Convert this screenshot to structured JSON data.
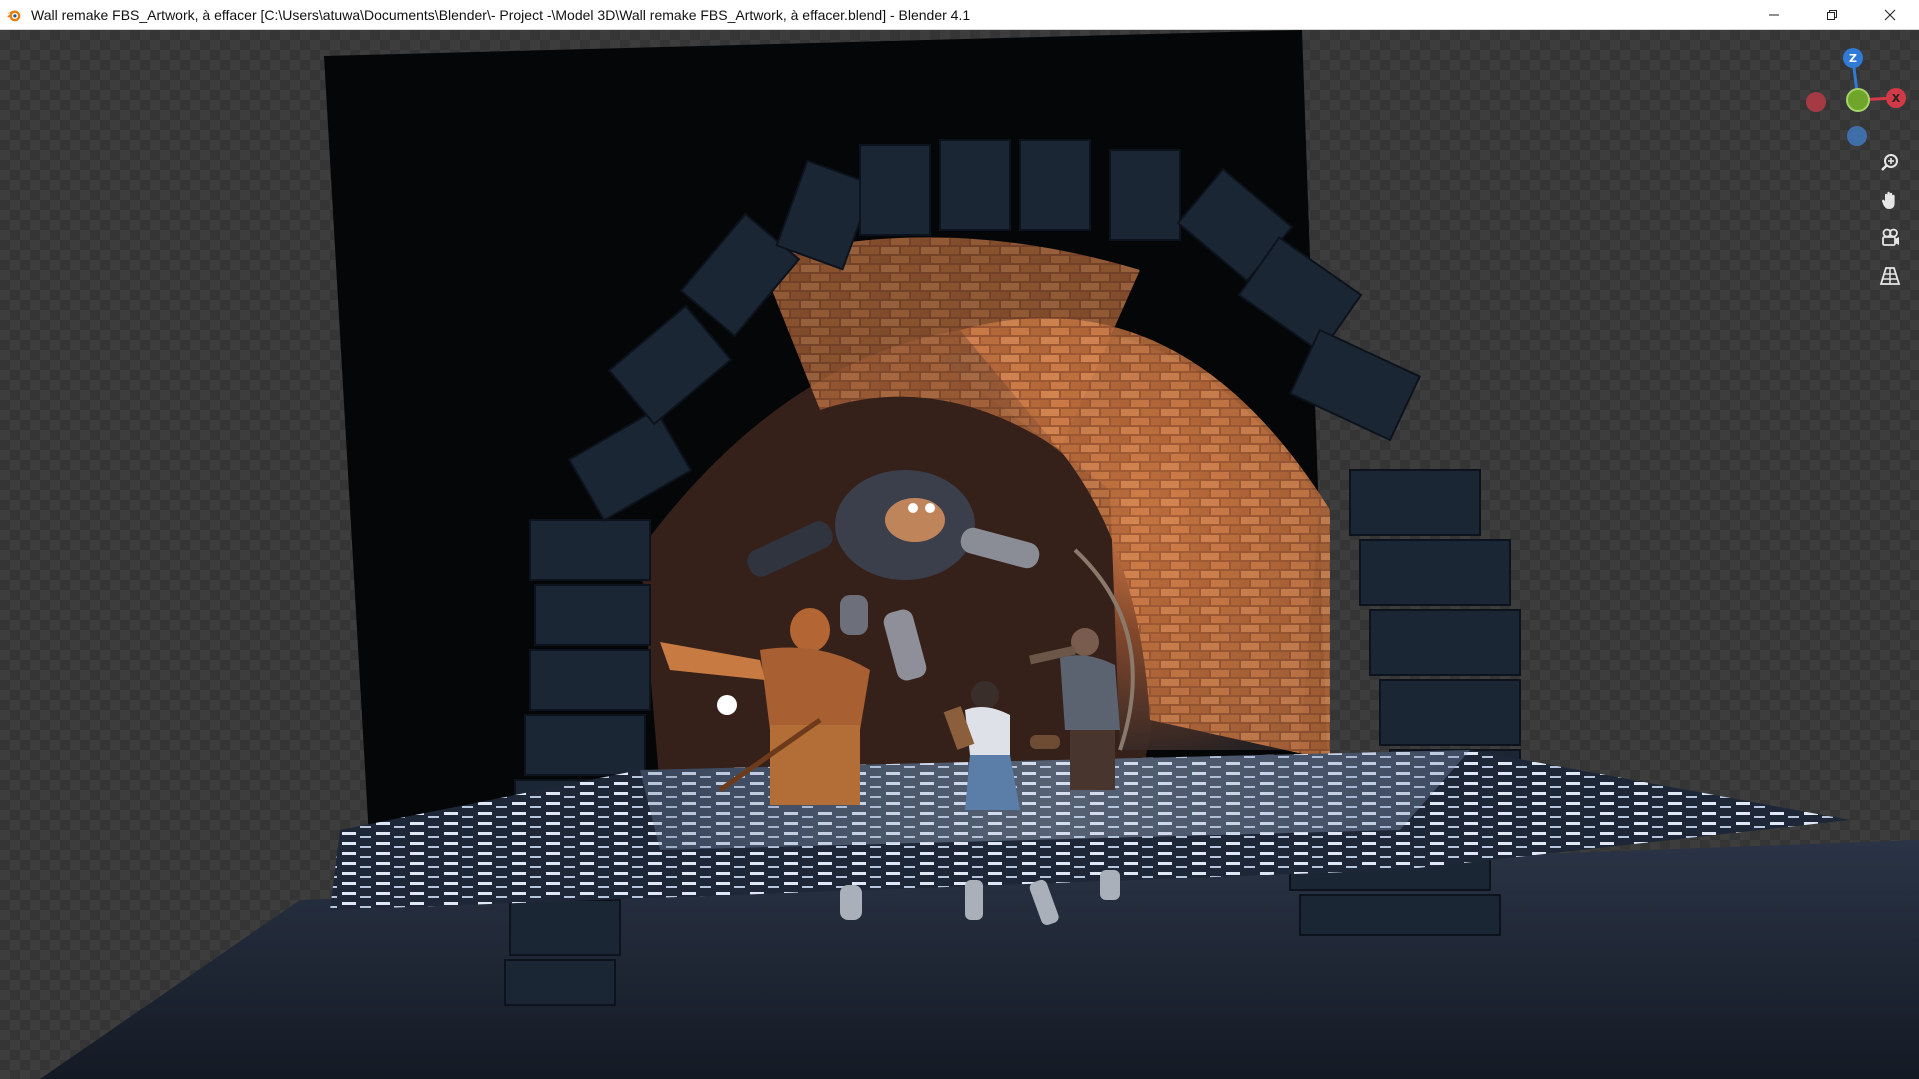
{
  "window": {
    "title": "Wall remake FBS_Artwork, à effacer [C:\\Users\\atuwa\\Documents\\Blender\\- Project -\\Model 3D\\Wall remake FBS_Artwork, à effacer.blend] - Blender 4.1",
    "app_icon": "blender-logo-icon",
    "controls": [
      "minimize-icon",
      "restore-icon",
      "close-icon"
    ]
  },
  "viewport": {
    "mode": "rendered",
    "scene_description_icons": [
      "stone-arch",
      "water-plane",
      "characters"
    ]
  },
  "gizmo": {
    "axes": {
      "z": {
        "label": "Z",
        "color": "#2f7bd6"
      },
      "x": {
        "label": "X",
        "color": "#d23a48"
      },
      "y": {
        "label": "",
        "color": "#6fa52a"
      },
      "neg_x": {
        "color": "#a63a44"
      },
      "neg_z": {
        "color": "#3e6fa8"
      }
    },
    "tools": [
      "zoom-icon",
      "pan-hand-icon",
      "camera-view-icon",
      "perspective-grid-icon"
    ]
  },
  "colors": {
    "accent_orange": "#c8703a",
    "stone_dark": "#1c2735",
    "water": "#8fa3c4",
    "background_checker": "#3d3d3d"
  }
}
